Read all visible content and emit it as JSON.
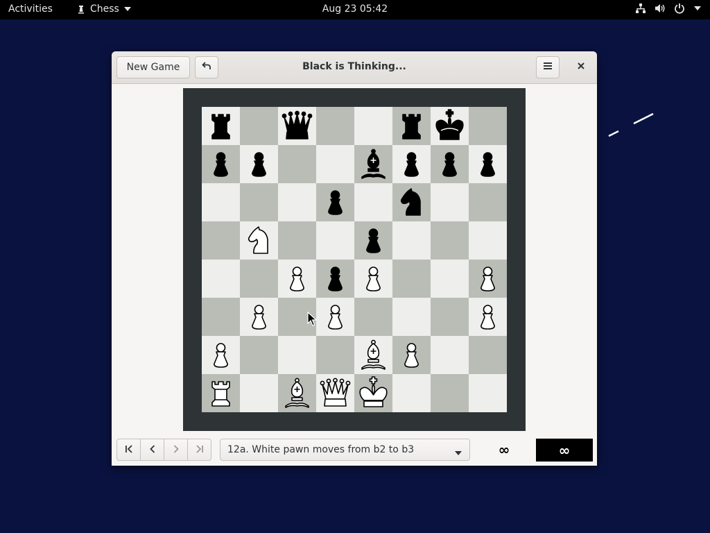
{
  "topbar": {
    "activities": "Activities",
    "app_name": "Chess",
    "clock": "Aug 23  05:42",
    "tray_icons": [
      "network-icon",
      "volume-icon",
      "power-icon",
      "chevron-down-icon"
    ]
  },
  "window": {
    "title": "Black is Thinking...",
    "new_game_label": "New Game",
    "undo_icon": "undo-icon",
    "menu_icon": "hamburger-icon",
    "close_icon": "close-icon"
  },
  "board": {
    "light_color": "#eeeeec",
    "dark_color": "#babdb6",
    "frame_color": "#2e3436",
    "ranks": [
      [
        "r",
        "",
        "q",
        "",
        "",
        "r",
        "k",
        ""
      ],
      [
        "p",
        "p",
        "",
        "",
        "b",
        "p",
        "p",
        "p"
      ],
      [
        "",
        "",
        "",
        "p",
        "",
        "n",
        "",
        ""
      ],
      [
        "",
        "N",
        "",
        "",
        "p",
        "",
        "",
        ""
      ],
      [
        "",
        "",
        "P",
        "p",
        "P",
        "",
        "",
        "P"
      ],
      [
        "",
        "P",
        "",
        "P",
        "",
        "",
        "",
        "P"
      ],
      [
        "P",
        "",
        "",
        "",
        "B",
        "P",
        "",
        ""
      ],
      [
        "R",
        "",
        "B",
        "Q",
        "K",
        "",
        "",
        ""
      ]
    ]
  },
  "history": {
    "nav_icons": [
      "first-move-icon",
      "previous-move-icon",
      "next-move-icon",
      "last-move-icon"
    ],
    "selected_move": "12a. White pawn moves from b2 to b3"
  },
  "clocks": {
    "white": "∞",
    "black": "∞"
  }
}
